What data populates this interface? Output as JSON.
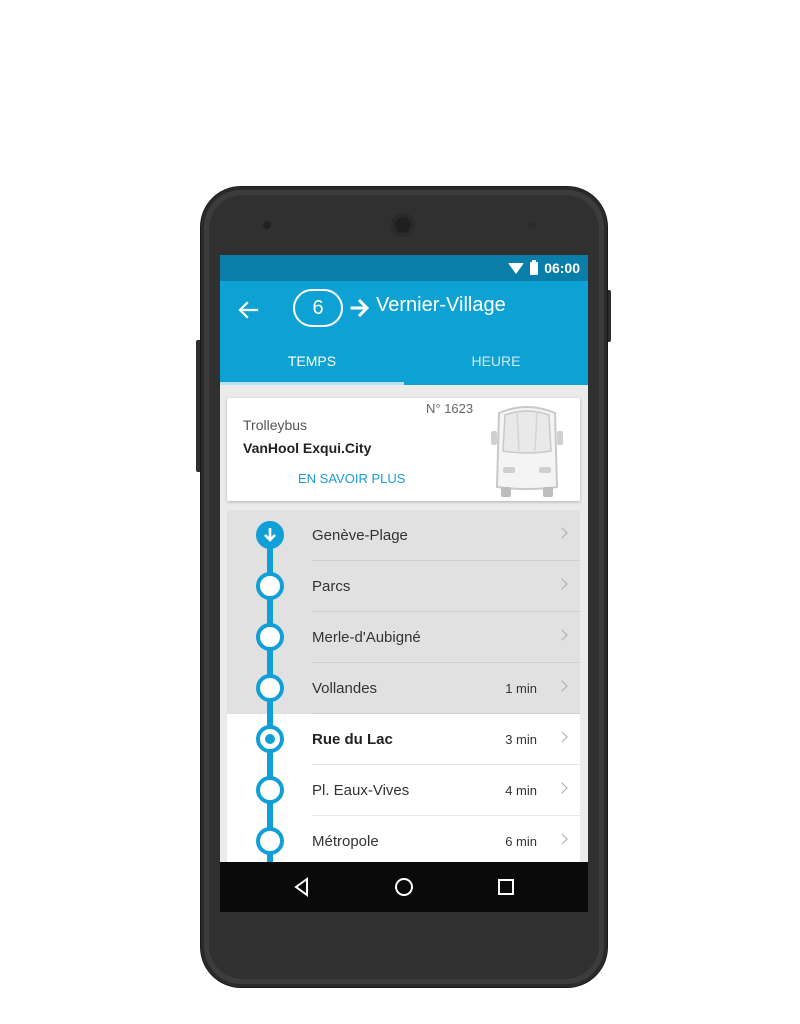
{
  "status_bar": {
    "time": "06:00",
    "wifi_icon": "wifi-icon",
    "battery_icon": "battery-icon"
  },
  "header": {
    "back_icon": "back-arrow-icon",
    "line_number": "6",
    "direction_icon": "arrow-right-icon",
    "destination": "Vernier-Village",
    "tabs": [
      {
        "label": "TEMPS",
        "active": true
      },
      {
        "label": "HEURE",
        "active": false
      }
    ]
  },
  "vehicle": {
    "number": "N° 1623",
    "type": "Trolleybus",
    "model": "VanHool Exqui.City",
    "more_label": "EN SAVOIR PLUS",
    "image_icon": "trolleybus-front-icon"
  },
  "stops": [
    {
      "name": "Genève-Plage",
      "eta": "",
      "state": "passed"
    },
    {
      "name": "Parcs",
      "eta": "",
      "state": "passed"
    },
    {
      "name": "Merle-d'Aubigné",
      "eta": "",
      "state": "passed"
    },
    {
      "name": "Vollandes",
      "eta": "1 min",
      "state": "passed"
    },
    {
      "name": "Rue du Lac",
      "eta": "3 min",
      "state": "current"
    },
    {
      "name": "Pl. Eaux-Vives",
      "eta": "4 min",
      "state": "future"
    },
    {
      "name": "Métropole",
      "eta": "6 min",
      "state": "future"
    }
  ],
  "nav": {
    "back_icon": "nav-back-icon",
    "home_icon": "nav-home-icon",
    "recent_icon": "nav-recent-icon"
  },
  "colors": {
    "primary": "#0ea2d4",
    "status_bar": "#0a7ea8",
    "accent": "#119fd8",
    "link": "#1a9bd6"
  }
}
